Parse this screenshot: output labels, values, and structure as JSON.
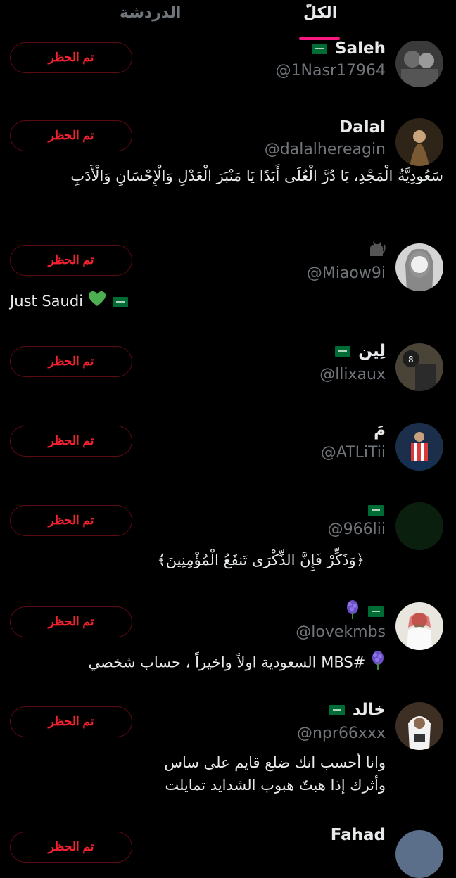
{
  "tabs": {
    "all": "الكلّ",
    "chat": "الدردشة"
  },
  "blocked_label": "تم الحظر",
  "users": [
    {
      "name": "Saleh",
      "handle": "@1Nasr17964",
      "bio": ""
    },
    {
      "name": "Dalal",
      "handle": "@dalalhereagin",
      "bio": "سَعُودِيَّةُ الْمَجْدِ، يَا دُرَّ الْعُلَى أَبَدًا يَا مَنْبَرَ الْعَدْلِ وَالْإِحْسَانِ وَالْأَدَبِ"
    },
    {
      "name": "",
      "handle": "@Miaow9i",
      "bio": "Just Saudi"
    },
    {
      "name": "لِين",
      "handle": "@llixaux",
      "bio": ""
    },
    {
      "name": "مَ",
      "handle": "@ATLiTii",
      "bio": ""
    },
    {
      "name": "",
      "handle": "@966lii",
      "bio": "﴿وَذَكِّرْ فَإِنَّ الذِّكْرَى تَنفَعُ الْمُؤْمِنِينَ﴾"
    },
    {
      "name": "",
      "handle": "@lovekmbs",
      "bio": "#MBS السعودية اولاً واخيراً ، حساب شخصي"
    },
    {
      "name": "خالد",
      "handle": "@npr66xxx",
      "bio": "وانا أحسب انك ضلع قايم على ساس وأثرك إذا هبتٌ هبوب الشدايد تمايلت"
    },
    {
      "name": "Fahad",
      "handle": "",
      "bio": ""
    }
  ],
  "icons": {
    "flag": "saudi-flag-icon",
    "cat": "black-cat-icon",
    "heart": "green-heart-icon",
    "hyacinth": "hyacinth-icon"
  },
  "colors": {
    "background": "#000000",
    "accent": "#f91880",
    "blocked_text": "#f4212e",
    "blocked_border": "#5c0b12",
    "secondary_text": "#71767b"
  }
}
